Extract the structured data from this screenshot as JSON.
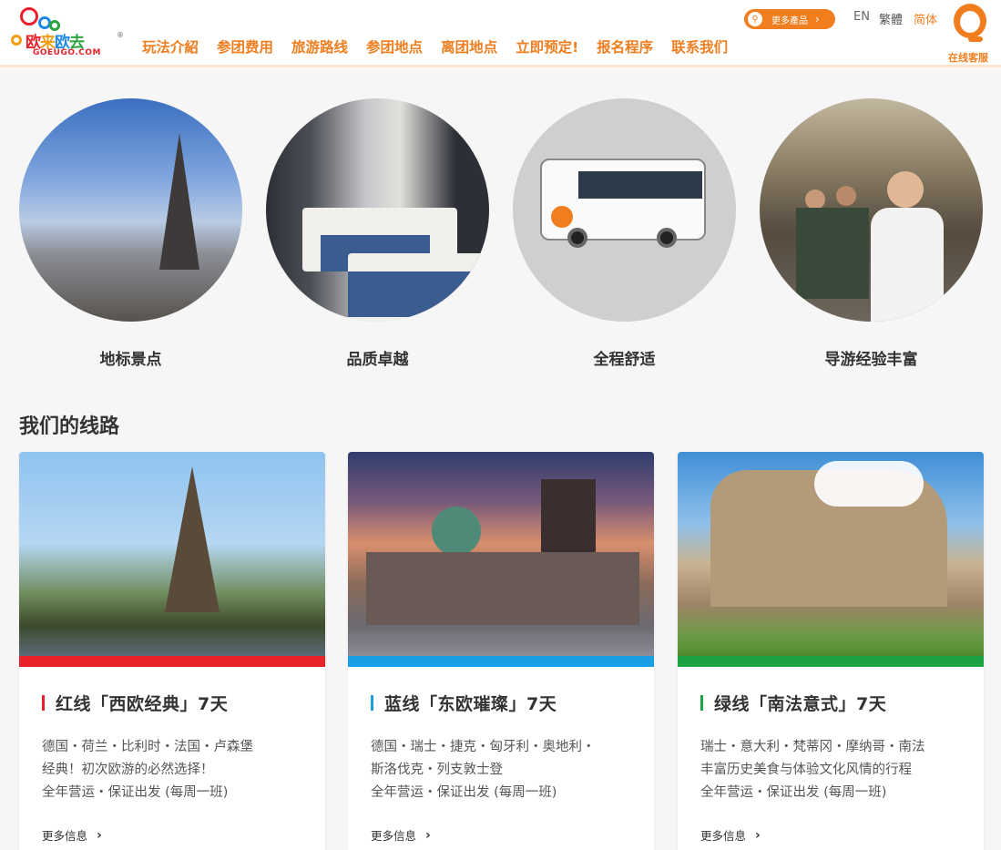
{
  "brand": {
    "logo_text": [
      "欧",
      "来",
      "欧",
      "去"
    ],
    "domain": "GOEUGO.COM",
    "registered": "®"
  },
  "nav": {
    "items": [
      "玩法介紹",
      "参团费用",
      "旅游路线",
      "参团地点",
      "离团地点",
      "立即预定!",
      "报名程序",
      "联系我们"
    ]
  },
  "header_right": {
    "more_products": "更多產品",
    "lang_en": "EN",
    "lang_tw": "繁體",
    "lang_cn": "简体",
    "customer_service": "在线客服"
  },
  "features": [
    {
      "label": "地标景点"
    },
    {
      "label": "品质卓越"
    },
    {
      "label": "全程舒适"
    },
    {
      "label": "导游经验丰富"
    }
  ],
  "section": {
    "title": "我们的线路"
  },
  "routes": [
    {
      "color": "#e8212a",
      "title": "红线「西欧经典」7天",
      "line1": "德国・荷兰・比利时・法国・卢森堡",
      "line2": "经典！初次欧游的必然选择！",
      "line3": "全年营运・保证出发 (每周一班)",
      "more": "更多信息"
    },
    {
      "color": "#1a9ee6",
      "title": "蓝线「东欧璀璨」7天",
      "line1": "德国・瑞士・捷克・匈牙利・奥地利・",
      "line2": "斯洛伐克・列支敦士登",
      "line3": "全年营运・保证出发 (每周一班)",
      "more": "更多信息"
    },
    {
      "color": "#1aa340",
      "title": "绿线「南法意式」7天",
      "line1": "瑞士・意大利・梵蒂冈・摩纳哥・南法",
      "line2": "丰富历史美食与体验文化风情的行程",
      "line3": "全年营运・保证出发 (每周一班)",
      "more": "更多信息"
    }
  ],
  "colors": {
    "accent": "#f07e1f",
    "red": "#e8212a",
    "blue": "#1a9ee6",
    "green": "#1aa340"
  }
}
